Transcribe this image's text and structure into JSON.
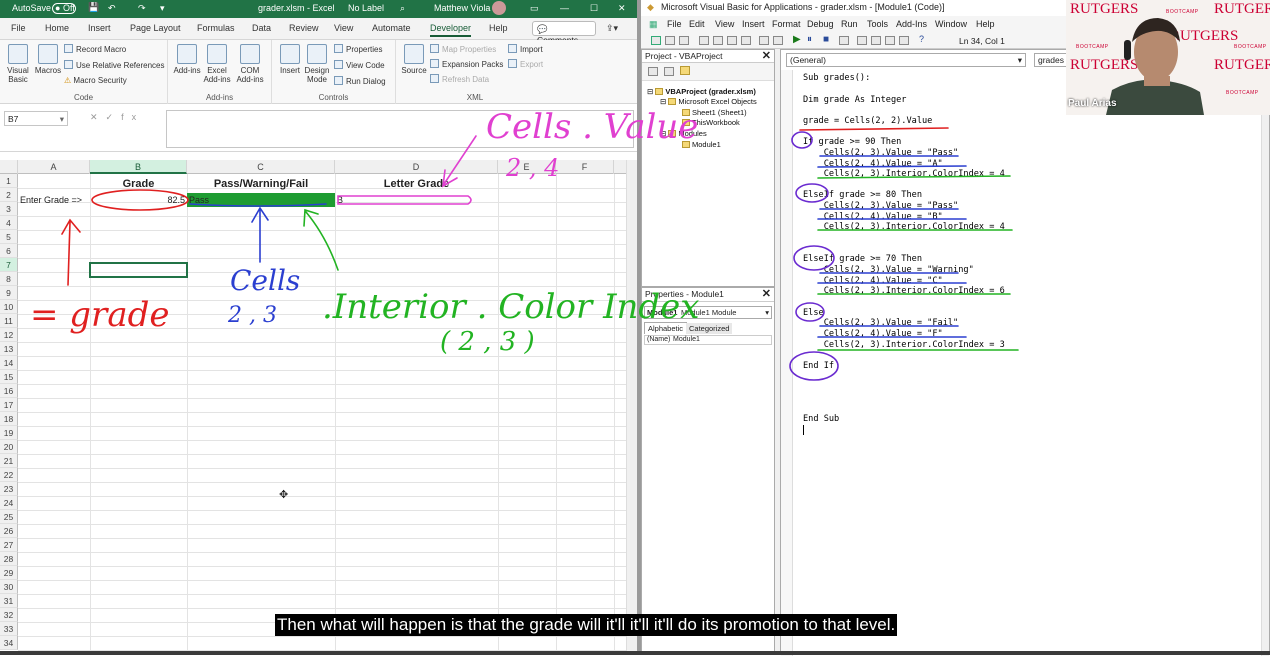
{
  "excel": {
    "autosave_label": "AutoSave",
    "autosave_state": "Off",
    "filename": "grader.xlsm  -  Excel",
    "sensitivity": "No Label",
    "user": "Matthew Viola",
    "tabs": [
      "File",
      "Home",
      "Insert",
      "Page Layout",
      "Formulas",
      "Data",
      "Review",
      "View",
      "Automate",
      "Developer",
      "Help"
    ],
    "active_tab": "Developer",
    "comments_label": "Comments",
    "ribbon": {
      "code_group": "Code",
      "visual_basic": "Visual Basic",
      "macros": "Macros",
      "record_macro": "Record Macro",
      "relative_refs": "Use Relative References",
      "macro_security": "Macro Security",
      "addins_group": "Add-ins",
      "addins": "Add-ins",
      "excel_addins": "Excel Add-ins",
      "com_addins": "COM Add-ins",
      "controls_group": "Controls",
      "insert": "Insert",
      "design_mode": "Design Mode",
      "properties": "Properties",
      "view_code": "View Code",
      "run_dialog": "Run Dialog",
      "xml_group": "XML",
      "source": "Source",
      "map_properties": "Map Properties",
      "expansion_packs": "Expansion Packs",
      "refresh_data": "Refresh Data",
      "import": "Import",
      "export": "Export"
    },
    "name_box": "B7",
    "columns": [
      "A",
      "B",
      "C",
      "D",
      "E",
      "F"
    ],
    "rows": [
      "1",
      "2",
      "3",
      "4",
      "5",
      "6",
      "7",
      "8",
      "9",
      "10",
      "11",
      "12",
      "13",
      "14",
      "15",
      "16",
      "17",
      "18",
      "19",
      "20",
      "21",
      "22",
      "23",
      "24",
      "25",
      "26",
      "27",
      "28",
      "29",
      "30",
      "31",
      "32",
      "33",
      "34"
    ],
    "cells": {
      "b1": "Grade",
      "c1": "Pass/Warning/Fail",
      "d1": "Letter Grade",
      "a2": "Enter Grade =>",
      "b2": "82.5",
      "c2": "Pass",
      "d2": "B"
    },
    "pass_fill": "#1e9c32"
  },
  "vba": {
    "title": "Microsoft Visual Basic for Applications - grader.xlsm - [Module1 (Code)]",
    "menu": [
      "File",
      "Edit",
      "View",
      "Insert",
      "Format",
      "Debug",
      "Run",
      "Tools",
      "Add-Ins",
      "Window",
      "Help"
    ],
    "position": "Ln 34, Col 1",
    "project_title": "Project - VBAProject",
    "tree": {
      "root": "VBAProject (grader.xlsm)",
      "objects": "Microsoft Excel Objects",
      "sheet1": "Sheet1 (Sheet1)",
      "workbook": "ThisWorkbook",
      "modules": "Modules",
      "module1": "Module1"
    },
    "properties_title": "Properties - Module1",
    "properties_object": "Module1 Module",
    "prop_tabs": [
      "Alphabetic",
      "Categorized"
    ],
    "prop_name_key": "(Name)",
    "prop_name_val": "Module1",
    "combo_general": "(General)",
    "combo_proc": "grades",
    "code": [
      "Sub grades():",
      "Dim grade As Integer",
      "grade = Cells(2, 2).Value",
      "If grade >= 90 Then",
      "    Cells(2, 3).Value = \"Pass\"",
      "    Cells(2, 4).Value = \"A\"",
      "    Cells(2, 3).Interior.ColorIndex = 4",
      "ElseIf grade >= 80 Then",
      "    Cells(2, 3).Value = \"Pass\"",
      "    Cells(2, 4).Value = \"B\"",
      "    Cells(2, 3).Interior.ColorIndex = 4",
      "ElseIf grade >= 70 Then",
      "    Cells(2, 3).Value = \"Warning\"",
      "    Cells(2, 4).Value = \"C\"",
      "    Cells(2, 3).Interior.ColorIndex = 6",
      "Else",
      "    Cells(2, 3).Value = \"Fail\"",
      "    Cells(2, 4).Value = \"F\"",
      "    Cells(2, 3).Interior.ColorIndex = 3",
      "End If",
      "End Sub"
    ]
  },
  "webcam": {
    "brand": "RUTGERS",
    "bootcamp": "BOOTCAMP",
    "name": "Paul Arias"
  },
  "annotations": {
    "cells_value": "Cells . Value",
    "cells_value_coords": "2 , 4",
    "grade": "= grade",
    "cells": "Cells",
    "cells_coords": "2 , 3",
    "interior": ".Interior . Color Index",
    "interior_coords": "( 2 , 3 )"
  },
  "caption": "Then what will happen is that the grade will it'll it'll it'll do its promotion to that level."
}
